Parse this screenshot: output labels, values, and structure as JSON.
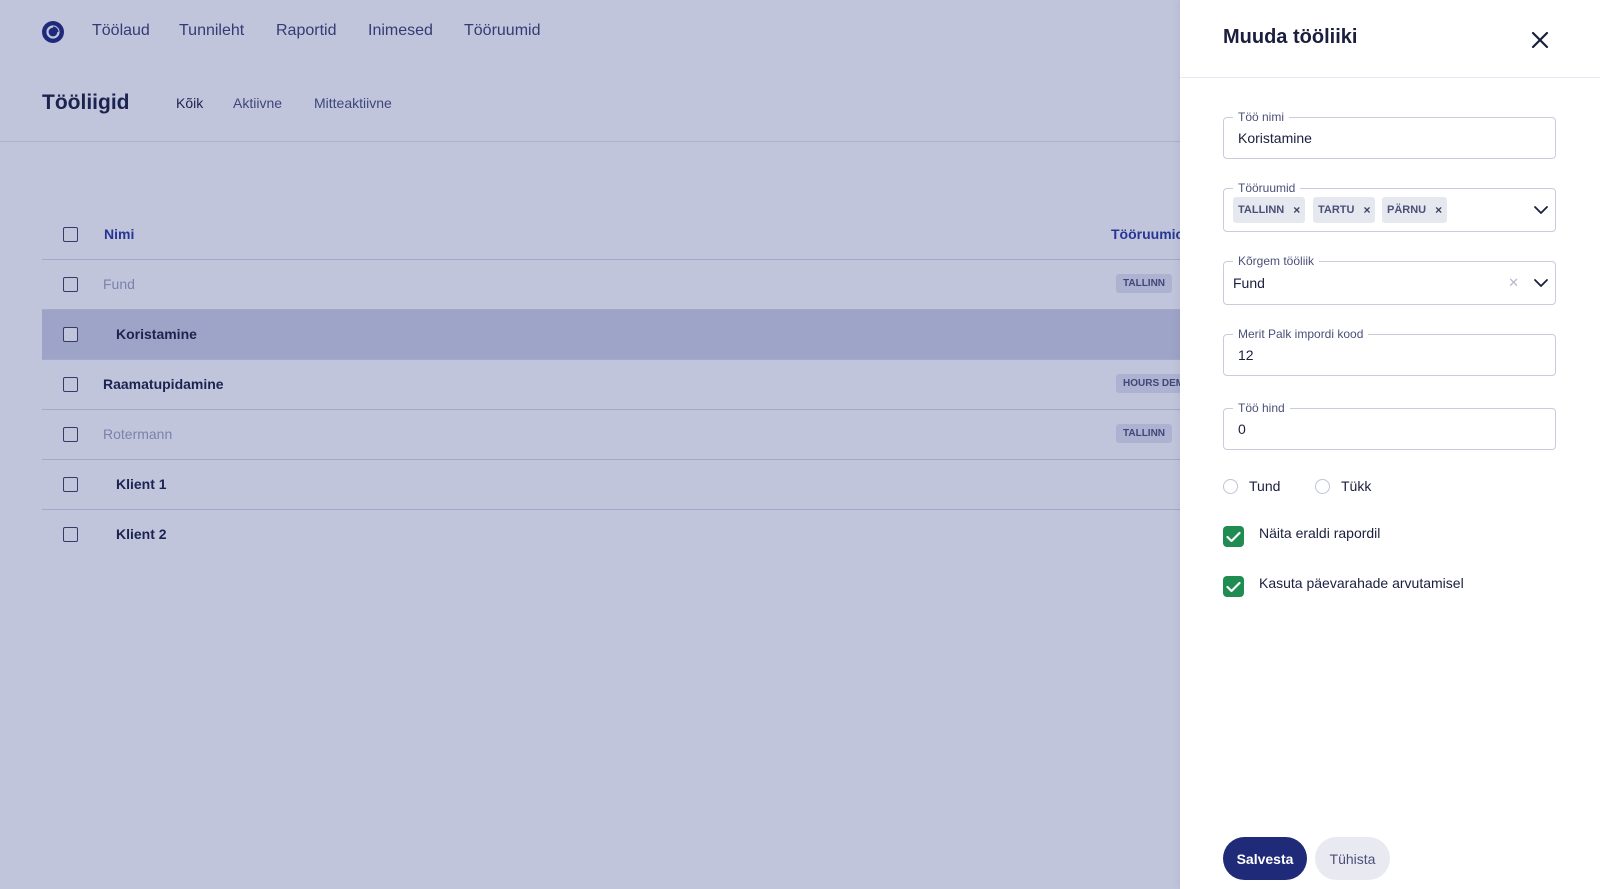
{
  "nav": {
    "items": [
      {
        "label": "Töölaud"
      },
      {
        "label": "Tunnileht"
      },
      {
        "label": "Raportid"
      },
      {
        "label": "Inimesed"
      },
      {
        "label": "Tööruumid"
      }
    ]
  },
  "page": {
    "title": "Tööliigid",
    "filters": [
      {
        "label": "Kõik",
        "active": true
      },
      {
        "label": "Aktiivne",
        "active": false
      },
      {
        "label": "Mitteaktiivne",
        "active": false
      }
    ]
  },
  "table": {
    "columns": {
      "name": "Nimi",
      "workspaces": "Tööruumic"
    },
    "rows": [
      {
        "name": "Fund",
        "tag": "TALLINN",
        "muted": true,
        "indent": false,
        "selected": false
      },
      {
        "name": "Koristamine",
        "tag": "",
        "muted": false,
        "indent": true,
        "selected": true
      },
      {
        "name": "Raamatupidamine",
        "tag": "HOURS DEM",
        "muted": false,
        "indent": false,
        "selected": false
      },
      {
        "name": "Rotermann",
        "tag": "TALLINN",
        "muted": true,
        "indent": false,
        "selected": false
      },
      {
        "name": "Klient 1",
        "tag": "",
        "muted": false,
        "indent": true,
        "selected": false
      },
      {
        "name": "Klient 2",
        "tag": "",
        "muted": false,
        "indent": true,
        "selected": false
      }
    ]
  },
  "panel": {
    "title": "Muuda tööliiki",
    "job_name": {
      "label": "Töö nimi",
      "value": "Koristamine"
    },
    "workspaces": {
      "label": "Tööruumid",
      "chips": [
        "TALLINN",
        "TARTU",
        "PÄRNU"
      ]
    },
    "parent": {
      "label": "Kõrgem tööliik",
      "value": "Fund"
    },
    "import_code": {
      "label": "Merit Palk impordi kood",
      "value": "12"
    },
    "price": {
      "label": "Töö hind",
      "value": "0"
    },
    "unit_options": [
      "Tund",
      "Tükk"
    ],
    "show_separately": {
      "label": "Näita eraldi rapordil",
      "checked": true
    },
    "per_diem": {
      "label": "Kasuta päevarahade arvutamisel",
      "checked": true
    },
    "save_label": "Salvesta",
    "cancel_label": "Tühista"
  },
  "colors": {
    "primary": "#1f2a78",
    "success": "#1f8c52",
    "overlay": "#222e80"
  }
}
